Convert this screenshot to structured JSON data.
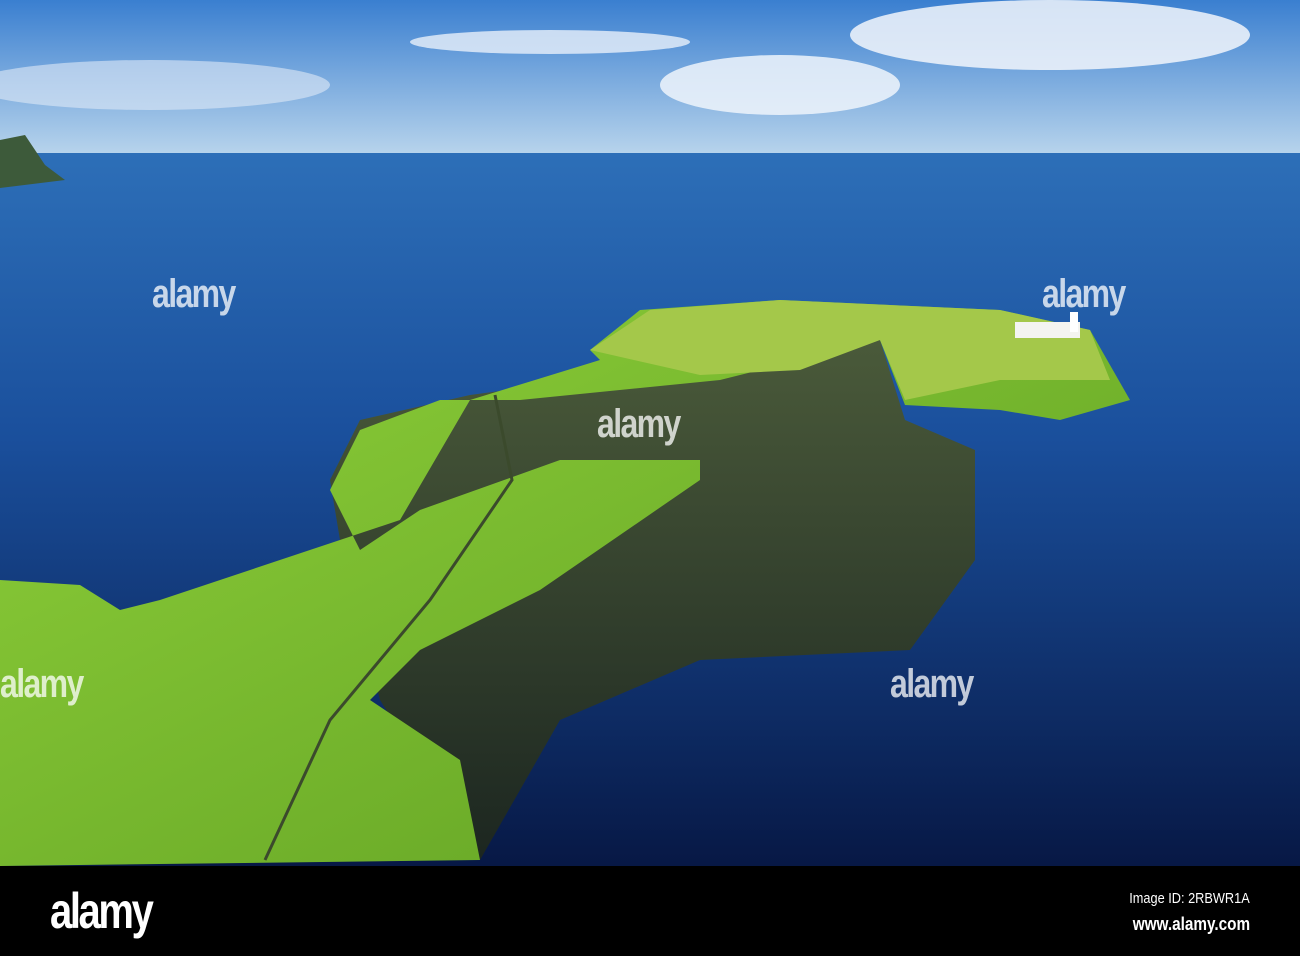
{
  "watermark": {
    "text": "alamy"
  },
  "footer": {
    "logo": "alamy",
    "image_id": "Image ID: 2RBWR1A",
    "url": "www.alamy.com"
  },
  "colors": {
    "sky_top": "#3a7fd0",
    "sea_near": "#0b1f5a",
    "sea_far": "#1f5aa8",
    "grass": "#7ec32a",
    "cliff": "#2c3a2a"
  }
}
